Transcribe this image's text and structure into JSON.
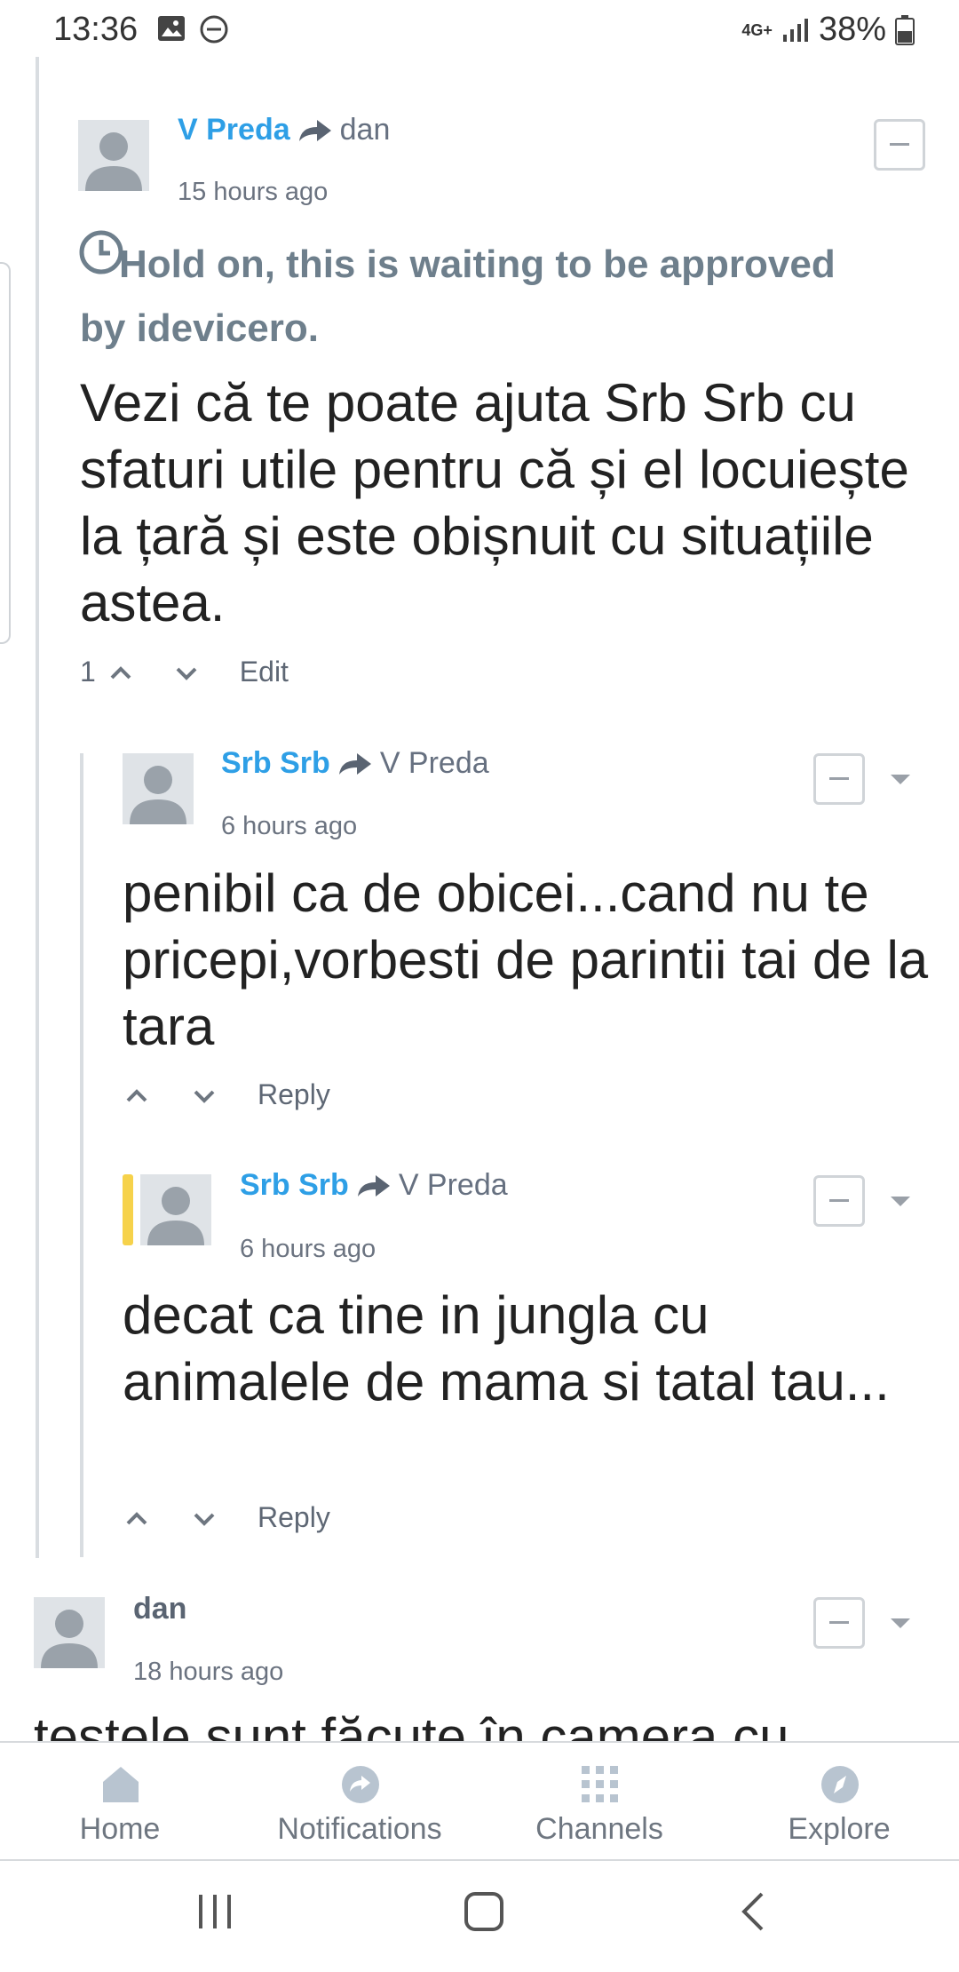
{
  "status_bar": {
    "time": "13:36",
    "network": "4G+",
    "battery": "38%"
  },
  "comments": [
    {
      "author": "V Preda",
      "reply_to": "dan",
      "time": "15 hours ago",
      "pending_notice": "Hold on, this is waiting to be approved by idevicero.",
      "text": "Vezi că te poate ajuta Srb Srb cu sfaturi utile pentru că și el locuiește la țară și este obișnuit cu situațiile astea.",
      "votes": "1",
      "action": "Edit"
    },
    {
      "author": "Srb Srb",
      "reply_to": "V Preda",
      "time": "6 hours ago",
      "text": "penibil ca de obicei...cand nu te pricepi,vorbesti de parintii tai de la tara",
      "action": "Reply"
    },
    {
      "author": "Srb Srb",
      "reply_to": "V Preda",
      "time": "6 hours ago",
      "text": "decat ca tine in jungla cu animalele de mama si tatal tau...",
      "action": "Reply"
    },
    {
      "author": "dan",
      "time": "18 hours ago",
      "text": "testele sunt făcute în camera cu"
    }
  ],
  "bottom_nav": [
    {
      "label": "Home",
      "icon": "home-icon"
    },
    {
      "label": "Notifications",
      "icon": "notifications-icon"
    },
    {
      "label": "Channels",
      "icon": "channels-icon"
    },
    {
      "label": "Explore",
      "icon": "explore-icon"
    }
  ],
  "colors": {
    "author": "#2e9fe6",
    "highlight": "#f6d24b",
    "pending": "#6e7f8c"
  }
}
